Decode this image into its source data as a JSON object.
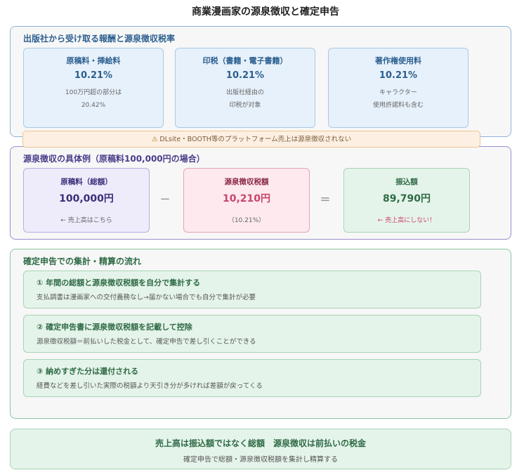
{
  "title": "商業漫画家の源泉徴収と確定申告",
  "section1": {
    "title": "出版社から受け取る報酬と源泉徴収税率",
    "cards": [
      {
        "label": "原稿料・挿絵料",
        "rate": "10.21%",
        "note1": "100万円超の部分は",
        "note2": "20.42%"
      },
      {
        "label": "印税（書籍・電子書籍）",
        "rate": "10.21%",
        "note1": "出版社経由の",
        "note2": "印税が対象"
      },
      {
        "label": "著作権使用料",
        "rate": "10.21%",
        "note1": "キャラクター",
        "note2": "使用許諾料も含む"
      }
    ]
  },
  "warning": {
    "icon": "warning-icon",
    "text": "DLsite・BOOTH等のプラットフォーム売上は源泉徴収されない"
  },
  "section2": {
    "title": "源泉徴収の具体例（原稿料100,000円の場合）",
    "gross": {
      "label": "原稿料（総額）",
      "amount": "100,000円",
      "note": "← 売上高はこちら"
    },
    "minus": "−",
    "tax": {
      "label": "源泉徴収税額",
      "amount": "10,210円",
      "note": "（10.21%）"
    },
    "equals": "=",
    "net": {
      "label": "振込額",
      "amount": "89,790円",
      "note": "← 売上高にしない！"
    }
  },
  "section3": {
    "title": "確定申告での集計・精算の流れ",
    "steps": [
      {
        "title": "① 年間の総額と源泉徴収税額を自分で集計する",
        "desc": "支払調書は漫画家への交付義務なし→届かない場合でも自分で集計が必要"
      },
      {
        "title": "② 確定申告書に源泉徴収税額を記載して控除",
        "desc": "源泉徴収税額＝前払いした税金として、確定申告で差し引くことができる"
      },
      {
        "title": "③ 納めすぎた分は還付される",
        "desc": "経費などを差し引いた実際の税額より天引き分が多ければ差額が戻ってくる"
      }
    ]
  },
  "summary": {
    "main": "売上高は振込額ではなく総額　源泉徴収は前払いの税金",
    "sub": "確定申告で総額・源泉徴収税額を集計し精算する"
  }
}
